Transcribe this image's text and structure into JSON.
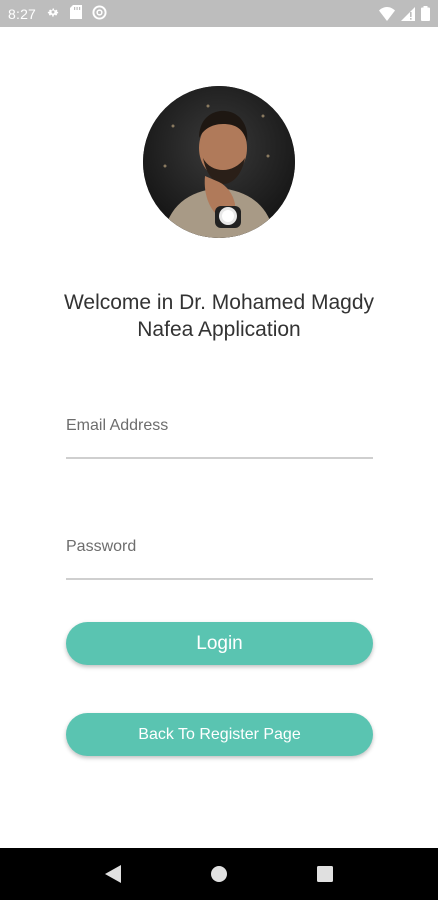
{
  "status_bar": {
    "time": "8:27",
    "left_icons": [
      "gear-icon",
      "sd-card-icon",
      "no-disturb-icon"
    ],
    "right_icons": [
      "wifi-icon",
      "signal-icon",
      "battery-icon"
    ]
  },
  "profile": {
    "avatar_icon": "profile-photo"
  },
  "welcome_text": "Welcome in Dr. Mohamed Magdy Nafea Application",
  "form": {
    "email_placeholder": "Email Address",
    "email_value": "",
    "password_placeholder": "Password",
    "password_value": ""
  },
  "buttons": {
    "login_label": "Login",
    "register_label": "Back To Register Page"
  },
  "nav_bar": {
    "icons": [
      "back-icon",
      "home-icon",
      "recents-icon"
    ]
  },
  "colors": {
    "accent": "#5ac4b1",
    "status_bar": "#bdbdbd",
    "nav_bar": "#000000",
    "field_underline": "#cfcfcf"
  }
}
